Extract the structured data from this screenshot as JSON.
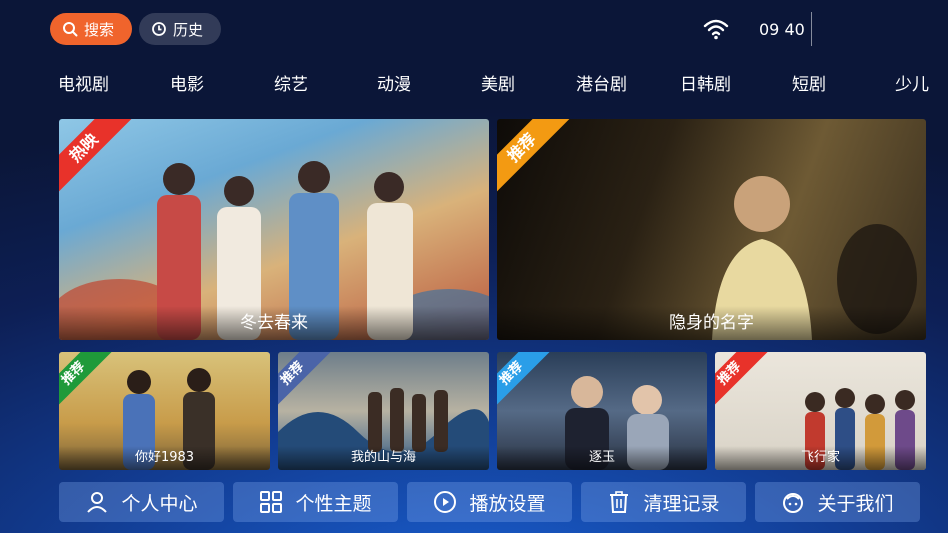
{
  "header": {
    "search_label": "搜索",
    "history_label": "历史",
    "time": "09 40"
  },
  "nav": {
    "tabs": [
      "电视剧",
      "电影",
      "综艺",
      "动漫",
      "美剧",
      "港台剧",
      "日韩剧",
      "短剧",
      "少儿"
    ]
  },
  "featured": [
    {
      "title": "冬去春来",
      "badge": "热映",
      "badge_color": "#e8322a"
    },
    {
      "title": "隐身的名字",
      "badge": "推荐",
      "badge_color": "#f39a12"
    }
  ],
  "recommended": [
    {
      "title": "你好1983",
      "badge": "推荐",
      "badge_color": "#1f9a3a"
    },
    {
      "title": "我的山与海",
      "badge": "推荐",
      "badge_color": "#4a64a8"
    },
    {
      "title": "逐玉",
      "badge": "推荐",
      "badge_color": "#2a9ee8"
    },
    {
      "title": "飞行家",
      "badge": "推荐",
      "badge_color": "#e8322a"
    }
  ],
  "menu": [
    {
      "label": "个人中心",
      "icon": "user-icon"
    },
    {
      "label": "个性主题",
      "icon": "theme-grid-icon"
    },
    {
      "label": "播放设置",
      "icon": "play-circle-icon"
    },
    {
      "label": "清理记录",
      "icon": "trash-icon"
    },
    {
      "label": "关于我们",
      "icon": "about-icon"
    }
  ],
  "colors": {
    "search_pill": "#f0642c",
    "background": "#0d1f55"
  }
}
